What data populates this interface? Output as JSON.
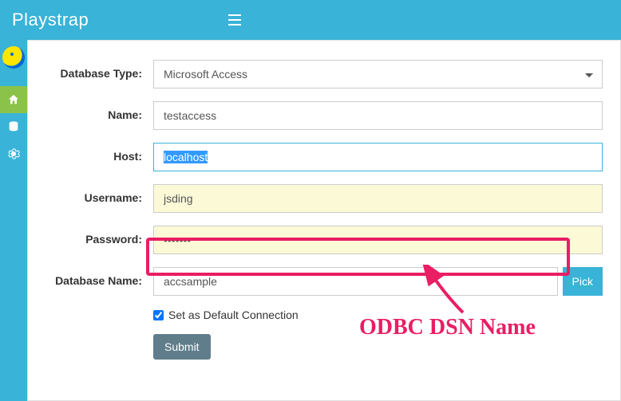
{
  "header": {
    "brand": "Playstrap"
  },
  "sidebar": {
    "items": [
      {
        "name": "home",
        "active": true
      },
      {
        "name": "database",
        "active": false
      },
      {
        "name": "settings",
        "active": false
      }
    ]
  },
  "form": {
    "database_type": {
      "label": "Database Type:",
      "value": "Microsoft Access"
    },
    "name": {
      "label": "Name:",
      "value": "testaccess"
    },
    "host": {
      "label": "Host:",
      "value": "localhost"
    },
    "username": {
      "label": "Username:",
      "value": "jsding"
    },
    "password": {
      "label": "Password:",
      "value": "•••••••"
    },
    "database_name": {
      "label": "Database Name:",
      "value": "accsample",
      "pick_label": "Pick"
    },
    "default_checkbox": {
      "label": "Set as Default Connection",
      "checked": true
    },
    "submit_label": "Submit"
  },
  "annotation": {
    "text": "ODBC DSN Name"
  }
}
